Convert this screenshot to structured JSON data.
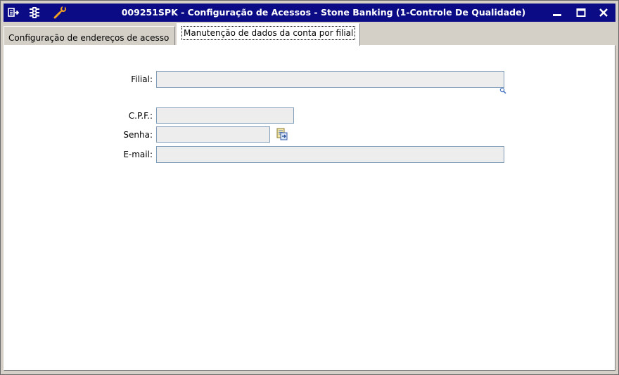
{
  "window": {
    "title": "009251SPK - Configuração de Acessos - Stone Banking (1-Controle De Qualidade)",
    "accent_color": "#0b0b86",
    "icons": [
      "exit-icon",
      "traffic-light-icon",
      "wrench-icon"
    ],
    "controls": [
      "minimize-icon",
      "maximize-icon",
      "close-icon"
    ]
  },
  "tabs": [
    {
      "label": "Configuração de endereços de acesso",
      "active": false
    },
    {
      "label": "Manutenção de dados da conta por filial",
      "active": true
    }
  ],
  "form": {
    "filial": {
      "label": "Filial:",
      "value": ""
    },
    "cpf": {
      "label": "C.P.F.:",
      "value": ""
    },
    "senha": {
      "label": "Senha:",
      "value": ""
    },
    "email": {
      "label": "E-mail:",
      "value": ""
    }
  }
}
